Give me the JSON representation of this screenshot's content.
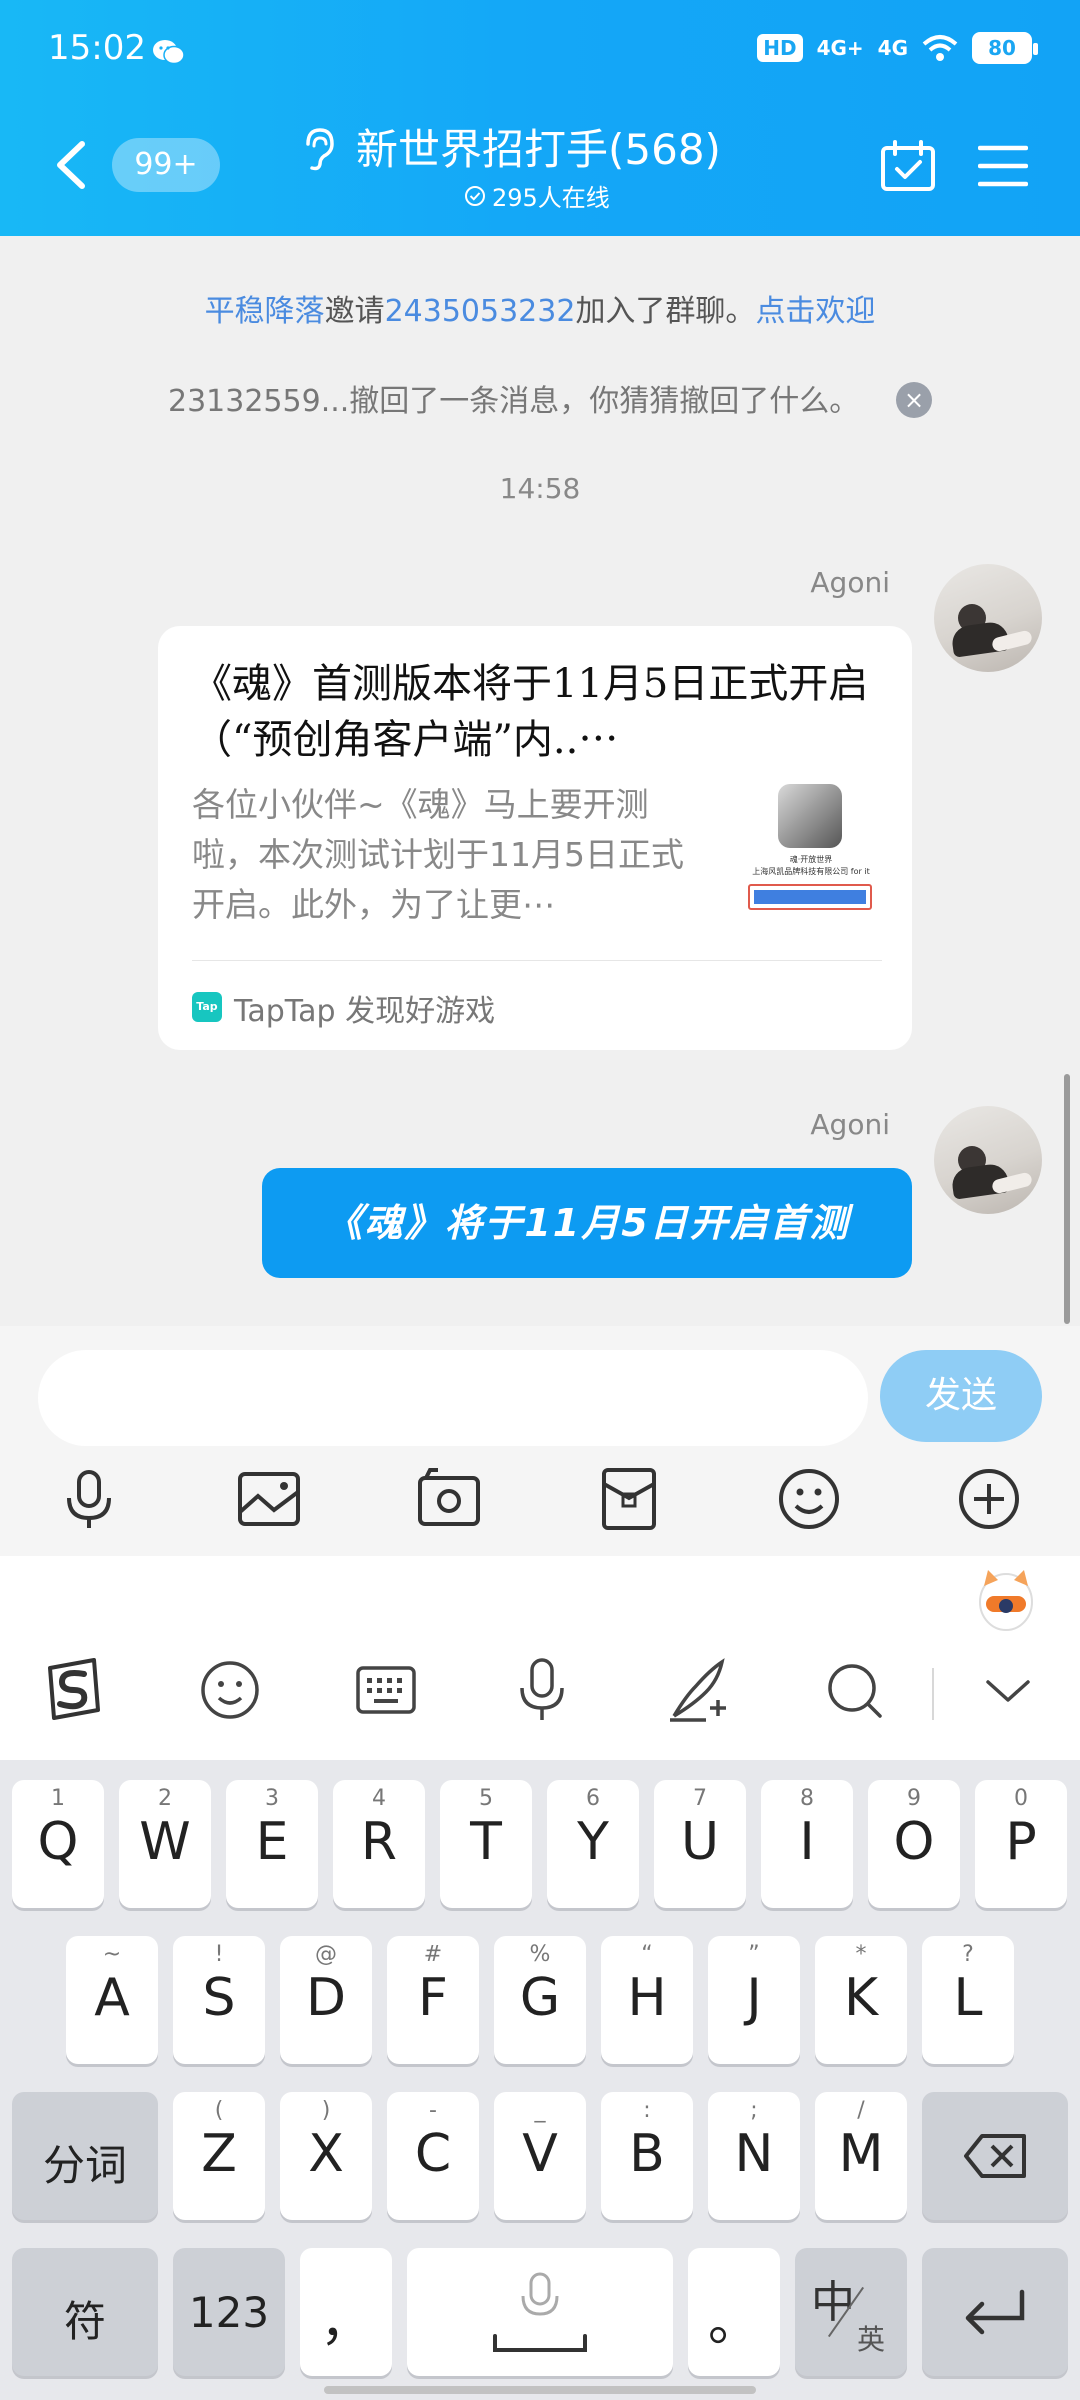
{
  "status_bar": {
    "time": "15:02",
    "hd": "HD",
    "net1": "4G+",
    "net2": "4G",
    "battery": "80"
  },
  "header": {
    "unread": "99+",
    "title": "新世界招打手(568)",
    "online": "295人在线"
  },
  "chat": {
    "system1": {
      "name": "平稳降落",
      "text1": "邀请",
      "invitee": "2435053232",
      "text2": "加入了群聊。",
      "action": "点击欢迎"
    },
    "system2": "23132559...撤回了一条消息，你猜猜撤回了什么。",
    "system2_close": "×",
    "timestamp": "14:58",
    "messages": [
      {
        "sender": "Agoni",
        "card": {
          "title": "《魂》首测版本将于11月5日正式开启（“预创角客户端”内..⋯",
          "description": "各位小伙伴~《魂》马上要开测啦，本次测试计划于11月5日正式开启。此外，为了让更⋯",
          "thumb_line1": "魂·开放世界",
          "thumb_line2": "上海风凯品牌科技有限公司 for it",
          "source_logo": "Tap",
          "source": "TapTap 发现好游戏"
        }
      },
      {
        "sender": "Agoni",
        "text": "《魂》将于11月5日开启首测"
      }
    ]
  },
  "input_bar": {
    "placeholder": "",
    "send": "发送",
    "tools": [
      "microphone-icon",
      "picture-icon",
      "camera-icon",
      "red-packet-icon",
      "emoji-icon",
      "plus-icon"
    ]
  },
  "keyboard": {
    "toolbar": [
      "sogou-logo-icon",
      "emoji-icon",
      "keyboard-icon",
      "microphone-icon",
      "handwriting-icon",
      "search-icon",
      "chevron-down-icon"
    ],
    "row1": [
      {
        "main": "Q",
        "sub": "1"
      },
      {
        "main": "W",
        "sub": "2"
      },
      {
        "main": "E",
        "sub": "3"
      },
      {
        "main": "R",
        "sub": "4"
      },
      {
        "main": "T",
        "sub": "5"
      },
      {
        "main": "Y",
        "sub": "6"
      },
      {
        "main": "U",
        "sub": "7"
      },
      {
        "main": "I",
        "sub": "8"
      },
      {
        "main": "O",
        "sub": "9"
      },
      {
        "main": "P",
        "sub": "0"
      }
    ],
    "row2": [
      {
        "main": "A",
        "sub": "~"
      },
      {
        "main": "S",
        "sub": "!"
      },
      {
        "main": "D",
        "sub": "@"
      },
      {
        "main": "F",
        "sub": "#"
      },
      {
        "main": "G",
        "sub": "%"
      },
      {
        "main": "H",
        "sub": "“"
      },
      {
        "main": "J",
        "sub": "”"
      },
      {
        "main": "K",
        "sub": "*"
      },
      {
        "main": "L",
        "sub": "?"
      }
    ],
    "row3": [
      {
        "main": "Z",
        "sub": "("
      },
      {
        "main": "X",
        "sub": ")"
      },
      {
        "main": "C",
        "sub": "-"
      },
      {
        "main": "V",
        "sub": "_"
      },
      {
        "main": "B",
        "sub": ":"
      },
      {
        "main": "N",
        "sub": ";"
      },
      {
        "main": "M",
        "sub": "/"
      }
    ],
    "fenci": "分词",
    "symbols": "符",
    "numbers": "123",
    "comma": "，",
    "period": "。",
    "lang_main": "中",
    "lang_sub": "英"
  }
}
